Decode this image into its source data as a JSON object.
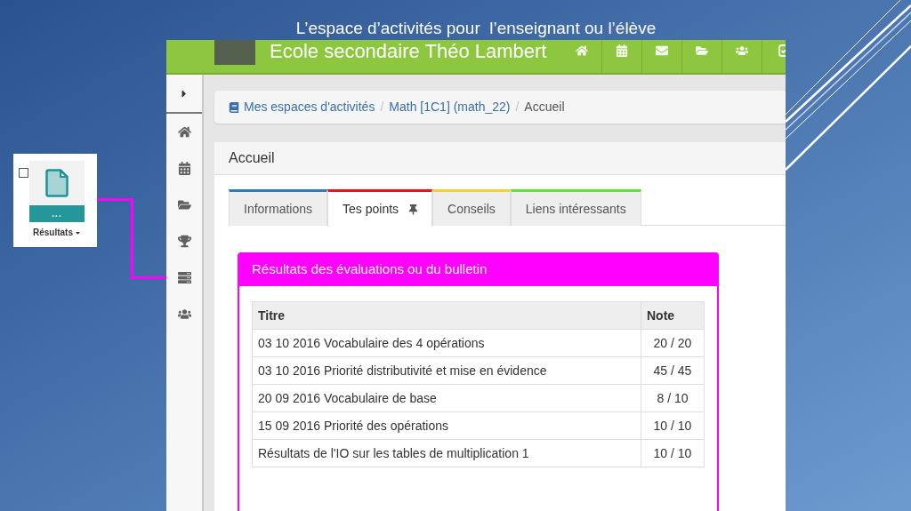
{
  "slide": {
    "title": "L’espace d’activités pour  l’enseignant ou l’élève"
  },
  "callout": {
    "checkbox": {
      "checked": false
    },
    "menu_button": "...",
    "label": "Résultats"
  },
  "app": {
    "header": {
      "school_name": "Ecole secondaire Théo Lambert"
    },
    "breadcrumb": {
      "items": [
        {
          "label": "Mes espaces d'activités",
          "current": false,
          "separator": "/"
        },
        {
          "label": "Math [1C1] (math_22)",
          "current": false,
          "separator": "/"
        },
        {
          "label": "Accueil",
          "current": true
        }
      ]
    },
    "panel": {
      "title": "Accueil",
      "tabs": [
        {
          "label": "Informations",
          "color": "#337ab7",
          "selected": false,
          "pinned": false
        },
        {
          "label": "Tes points",
          "color": "#e8141c",
          "selected": true,
          "pinned": true
        },
        {
          "label": "Conseils",
          "color": "#f2d13a",
          "selected": false,
          "pinned": false
        },
        {
          "label": "Liens intéressants",
          "color": "#63e23a",
          "selected": false,
          "pinned": false
        }
      ],
      "results": {
        "title": "Résultats des évaluations ou du bulletin",
        "table": {
          "columns": [
            "Titre",
            "Note"
          ],
          "rows": [
            {
              "titre": "03 10 2016 Vocabulaire des 4 opérations",
              "note": "20 / 20"
            },
            {
              "titre": "03 10 2016 Priorité distributivité et mise en évidence",
              "note": "45 / 45"
            },
            {
              "titre": "20 09 2016 Vocabulaire de base",
              "note": "8 / 10"
            },
            {
              "titre": "15 09 2016 Priorité des opérations",
              "note": "10 / 10"
            },
            {
              "titre": "Résultats de l'IO sur les tables de multiplication 1",
              "note": "10 / 10"
            }
          ]
        }
      }
    }
  }
}
